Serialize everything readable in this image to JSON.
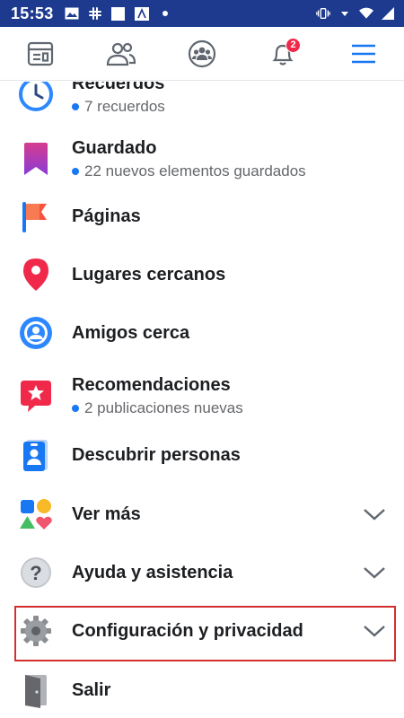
{
  "status_bar": {
    "time": "15:53",
    "icons": [
      "image-icon",
      "slack-icon",
      "square-icon",
      "font-icon",
      "dot-icon",
      "vibrate-icon",
      "wifi-icon",
      "signal-icon"
    ]
  },
  "nav": {
    "items": [
      "news-feed-icon",
      "friends-icon",
      "groups-icon",
      "notifications-icon",
      "menu-icon"
    ],
    "notifications_badge": "2"
  },
  "menu": {
    "items": [
      {
        "label": "Recuerdos",
        "sub": "7 recuerdos",
        "icon": "memories-clock-icon"
      },
      {
        "label": "Guardado",
        "sub": "22 nuevos elementos guardados",
        "icon": "saved-bookmark-icon"
      },
      {
        "label": "Páginas",
        "icon": "pages-flag-icon"
      },
      {
        "label": "Lugares cercanos",
        "icon": "location-pin-icon"
      },
      {
        "label": "Amigos cerca",
        "icon": "friends-nearby-icon"
      },
      {
        "label": "Recomendaciones",
        "sub": "2 publicaciones nuevas",
        "icon": "recommendations-icon"
      },
      {
        "label": "Descubrir personas",
        "icon": "discover-people-icon"
      },
      {
        "label": "Ver más",
        "icon": "see-more-icon"
      },
      {
        "label": "Ayuda y asistencia",
        "icon": "help-icon"
      },
      {
        "label": "Configuración y privacidad",
        "icon": "gear-icon"
      },
      {
        "label": "Salir",
        "icon": "logout-door-icon"
      }
    ]
  },
  "colors": {
    "status_bar": "#1d3a8f",
    "accent": "#1877f2",
    "badge": "#f02849",
    "highlight": "#d32f2f"
  }
}
